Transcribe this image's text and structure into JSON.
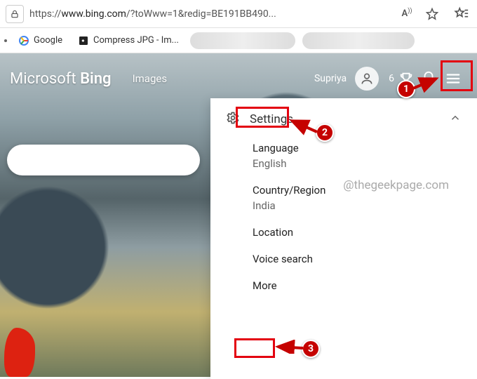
{
  "browser": {
    "url_prefix": "https://",
    "url_host": "www.bing.com",
    "url_rest": "/?toWww=1&redig=BE191BB490...",
    "reader_label": "A",
    "bookmarks": [
      {
        "label": "Google",
        "icon": "google"
      },
      {
        "label": "Compress JPG - Im...",
        "icon": "compress"
      }
    ]
  },
  "bing": {
    "logo_prefix": "Microsoft ",
    "logo_main": "Bing",
    "nav_images": "Images",
    "user_name": "Supriya",
    "points": "6"
  },
  "panel": {
    "title": "Settings",
    "items": [
      {
        "label": "Language",
        "value": "English"
      },
      {
        "label": "Country/Region",
        "value": "India"
      },
      {
        "label": "Location",
        "value": ""
      },
      {
        "label": "Voice search",
        "value": ""
      }
    ],
    "more_label": "More"
  },
  "annotations": {
    "badge1": "1",
    "badge2": "2",
    "badge3": "3",
    "watermark": "@thegeekpage.com"
  }
}
